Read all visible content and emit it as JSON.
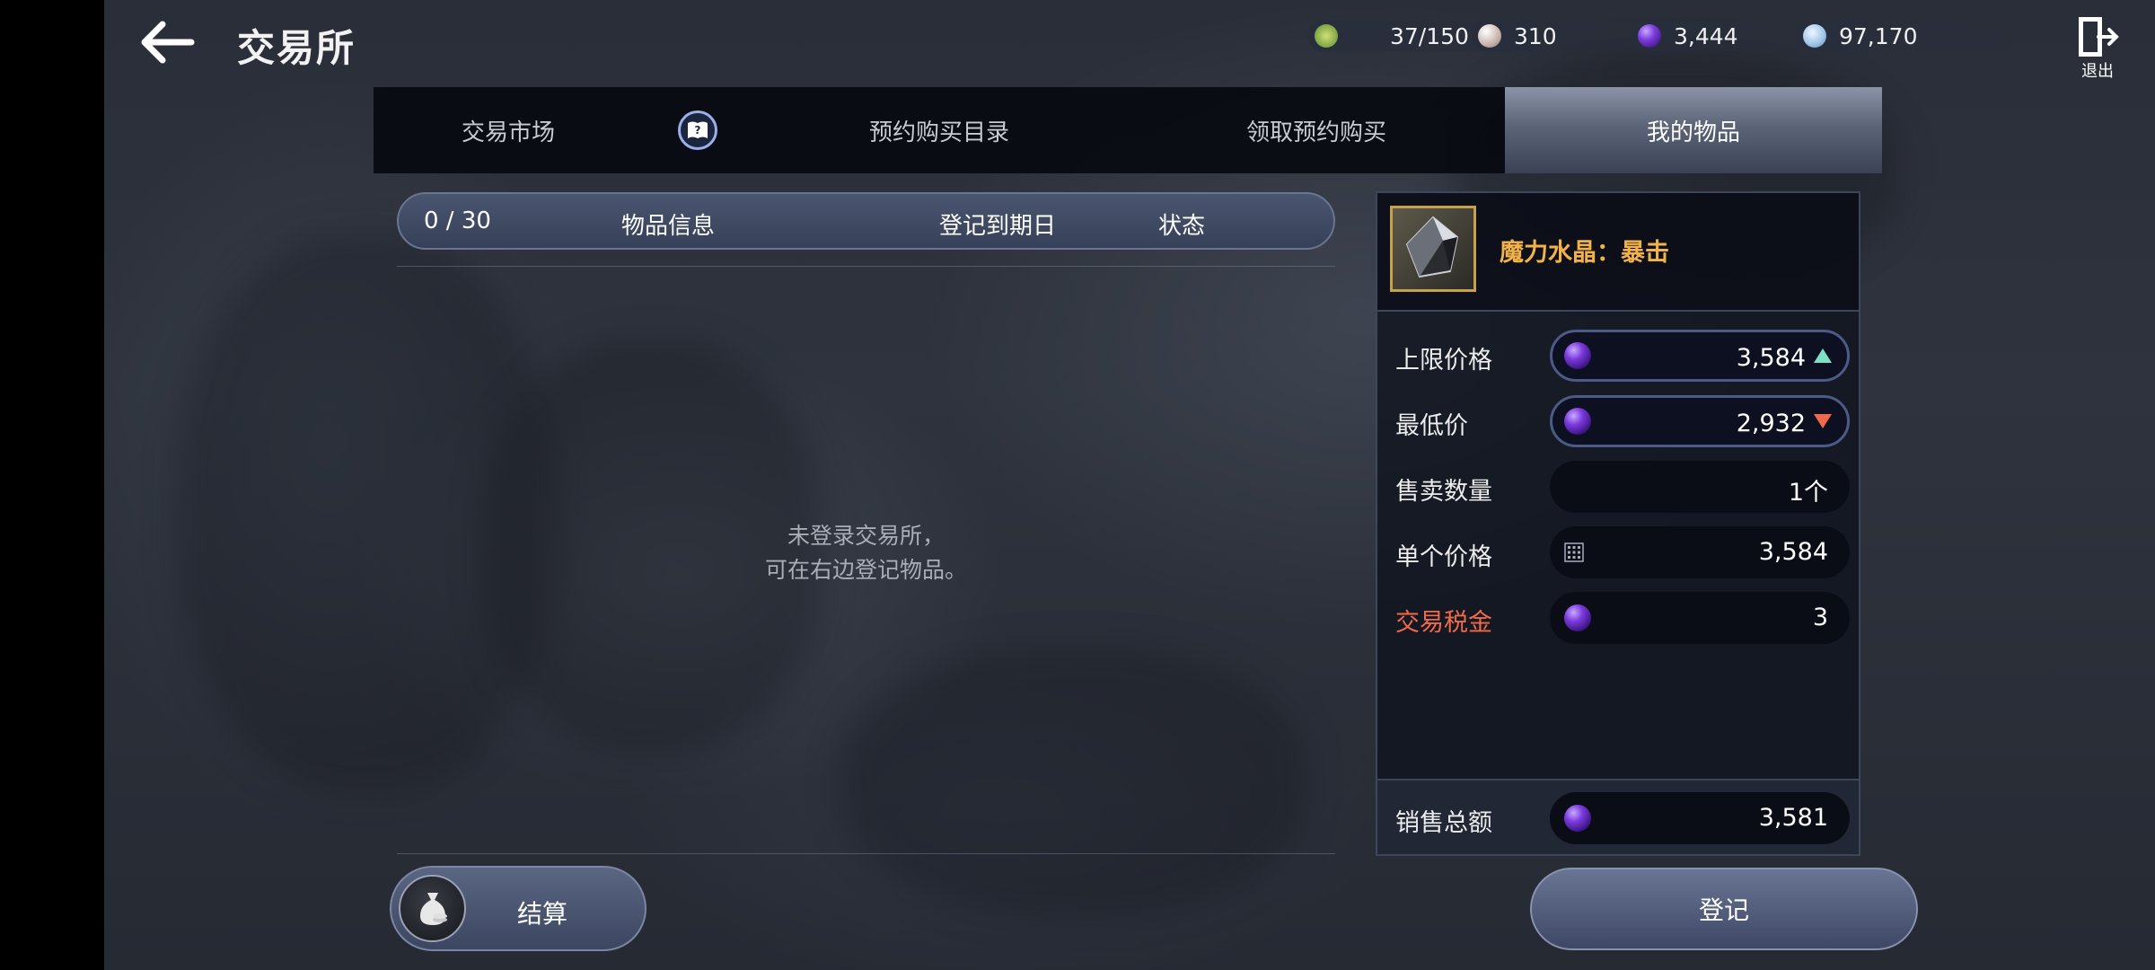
{
  "header": {
    "title": "交易所",
    "exit_label": "退出"
  },
  "currencies": [
    {
      "icon": "stamina-icon",
      "value": "37/150",
      "color": "#8fbf4a"
    },
    {
      "icon": "pearl-icon",
      "value": "310",
      "color": "#e6d6d0"
    },
    {
      "icon": "purple-gem-icon",
      "value": "3,444",
      "color": "#7b3bdc"
    },
    {
      "icon": "silver-coin-icon",
      "value": "97,170",
      "color": "#b9d6f0"
    }
  ],
  "tabs": [
    {
      "label": "交易市场",
      "active": false
    },
    {
      "label": "预约购买目录",
      "active": false
    },
    {
      "label": "领取预约购买",
      "active": false
    },
    {
      "label": "我的物品",
      "active": true
    }
  ],
  "list": {
    "count": "0 / 30",
    "col_item": "物品信息",
    "col_expiry": "登记到期日",
    "col_status": "状态",
    "empty_line1": "未登录交易所，",
    "empty_line2": "可在右边登记物品。"
  },
  "settle_label": "结算",
  "item": {
    "name": "魔力水晶：暴击",
    "fields": {
      "max_price": {
        "label": "上限价格",
        "value": "3,584"
      },
      "min_price": {
        "label": "最低价",
        "value": "2,932"
      },
      "quantity": {
        "label": "售卖数量",
        "value": "1个"
      },
      "unit_price": {
        "label": "单个价格",
        "value": "3,584"
      },
      "tax": {
        "label": "交易税金",
        "value": "3"
      },
      "total": {
        "label": "销售总额",
        "value": "3,581"
      }
    }
  },
  "register_label": "登记",
  "colors": {
    "accent_gold": "#f2b24a",
    "tax_red": "#f06a4a",
    "up_arrow": "#7fe0c8",
    "down_arrow": "#ef6a4a"
  }
}
